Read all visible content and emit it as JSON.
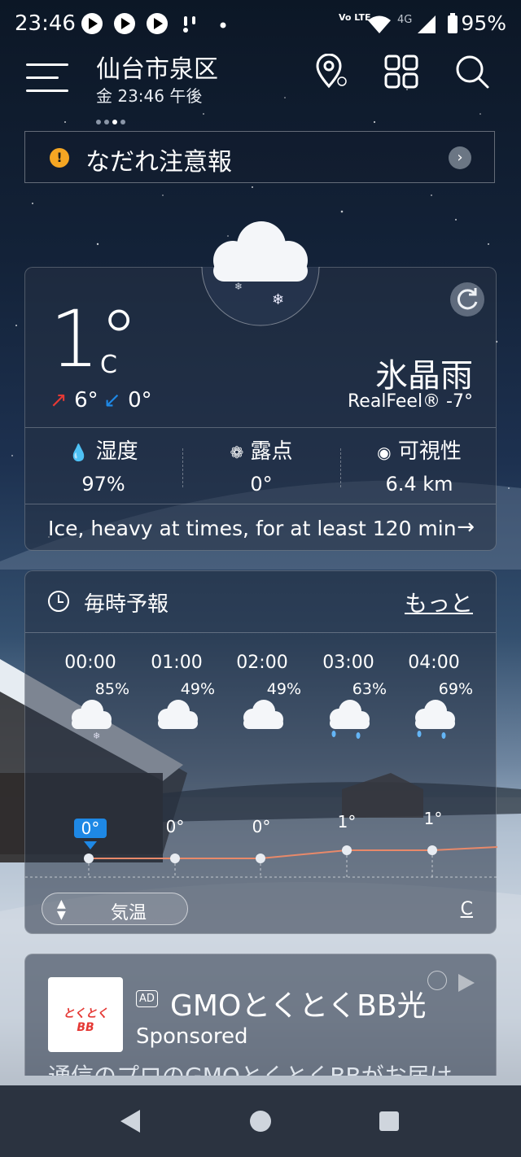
{
  "status_bar": {
    "time": "23:46",
    "volte": "Vo LTE",
    "network": "4G",
    "battery": "95%"
  },
  "header": {
    "city": "仙台市泉区",
    "datetime": "金 23:46 午後",
    "icons": [
      "menu-icon",
      "location-pin-icon",
      "grid-icon",
      "search-icon"
    ]
  },
  "alert": {
    "text": "なだれ注意報",
    "icon": "!"
  },
  "current": {
    "temperature": "1°",
    "unit": "C",
    "high": "6°",
    "low": "0°",
    "condition": "氷晶雨",
    "realfeel": "RealFeel® -7°",
    "stats": [
      {
        "label": "湿度",
        "value": "97%",
        "icon": "droplet-icon"
      },
      {
        "label": "露点",
        "value": "0°",
        "icon": "dewpoint-icon"
      },
      {
        "label": "可視性",
        "value": "6.4 km",
        "icon": "eye-icon"
      }
    ],
    "minutecast": "Ice, heavy at times, for at least 120 min",
    "minutecast_arrow": "→"
  },
  "hourly": {
    "title": "毎時予報",
    "more": "もっと",
    "hours": [
      {
        "time": "00:00",
        "precip": "85%",
        "temp": "0°",
        "icon": "cloud-snow-icon",
        "temp_value": 0,
        "selected": true
      },
      {
        "time": "01:00",
        "precip": "49%",
        "temp": "0°",
        "icon": "cloud-icon",
        "temp_value": 0,
        "selected": false
      },
      {
        "time": "02:00",
        "precip": "49%",
        "temp": "0°",
        "icon": "cloud-icon",
        "temp_value": 0,
        "selected": false
      },
      {
        "time": "03:00",
        "precip": "63%",
        "temp": "1°",
        "icon": "cloud-rain-icon",
        "temp_value": 1,
        "selected": false
      },
      {
        "time": "04:00",
        "precip": "69%",
        "temp": "1°",
        "icon": "cloud-rain-icon",
        "temp_value": 1,
        "selected": false
      }
    ],
    "metric_label": "気温",
    "unit_toggle": "C",
    "line_color": "#e8896a"
  },
  "ad": {
    "badge": "AD",
    "title": "GMOとくとくBB光",
    "sponsored": "Sponsored",
    "body": "通信のプロのGMOとくとくBBがお届け",
    "logo_text": "とくとくBB"
  },
  "colors": {
    "alert": "#f5a623",
    "high_arrow": "#e53935",
    "low_arrow": "#1e88e5",
    "selected_badge": "#1e88e5"
  }
}
